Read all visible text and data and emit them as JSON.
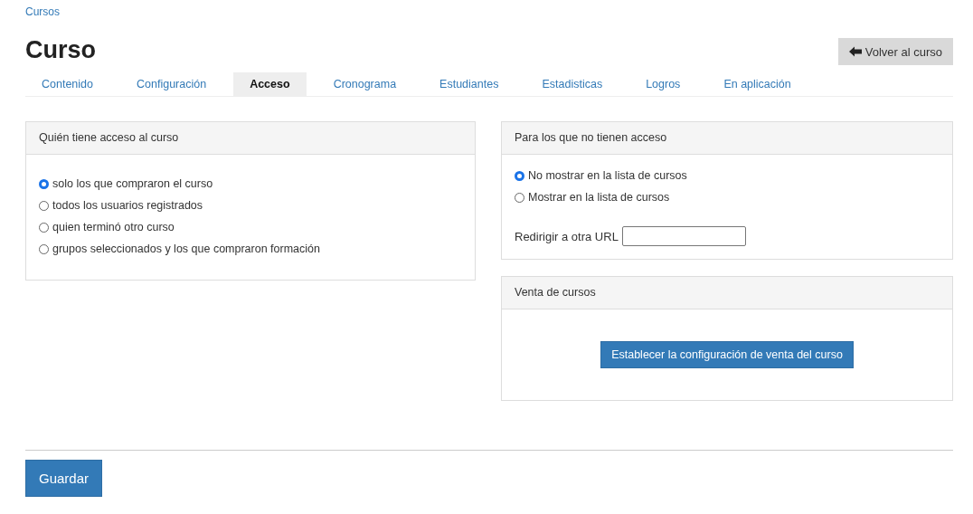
{
  "breadcrumb": "Cursos",
  "title": "Curso",
  "back_button": "Volver al curso",
  "tabs": [
    {
      "label": "Contenido",
      "selected": false
    },
    {
      "label": "Configuración",
      "selected": false
    },
    {
      "label": "Acceso",
      "selected": true
    },
    {
      "label": "Cronograma",
      "selected": false
    },
    {
      "label": "Estudiantes",
      "selected": false
    },
    {
      "label": "Estadisticas",
      "selected": false
    },
    {
      "label": "Logros",
      "selected": false
    },
    {
      "label": "En aplicación",
      "selected": false
    }
  ],
  "access_panel": {
    "title": "Quién tiene acceso al curso",
    "options": [
      {
        "label": "solo los que compraron el curso",
        "selected": true
      },
      {
        "label": "todos los usuarios registrados",
        "selected": false
      },
      {
        "label": "quien terminó otro curso",
        "selected": false
      },
      {
        "label": "grupos seleccionados y los que compraron formación",
        "selected": false
      }
    ]
  },
  "no_access_panel": {
    "title": "Para los que no tienen acceso",
    "options": [
      {
        "label": "No mostrar en la lista de cursos",
        "selected": true
      },
      {
        "label": "Mostrar en la lista de cursos",
        "selected": false
      }
    ],
    "redirect_label": "Redirigir a otra URL"
  },
  "sales_panel": {
    "title": "Venta de cursos",
    "button": "Establecer la configuración de venta del curso"
  },
  "save_button": "Guardar"
}
